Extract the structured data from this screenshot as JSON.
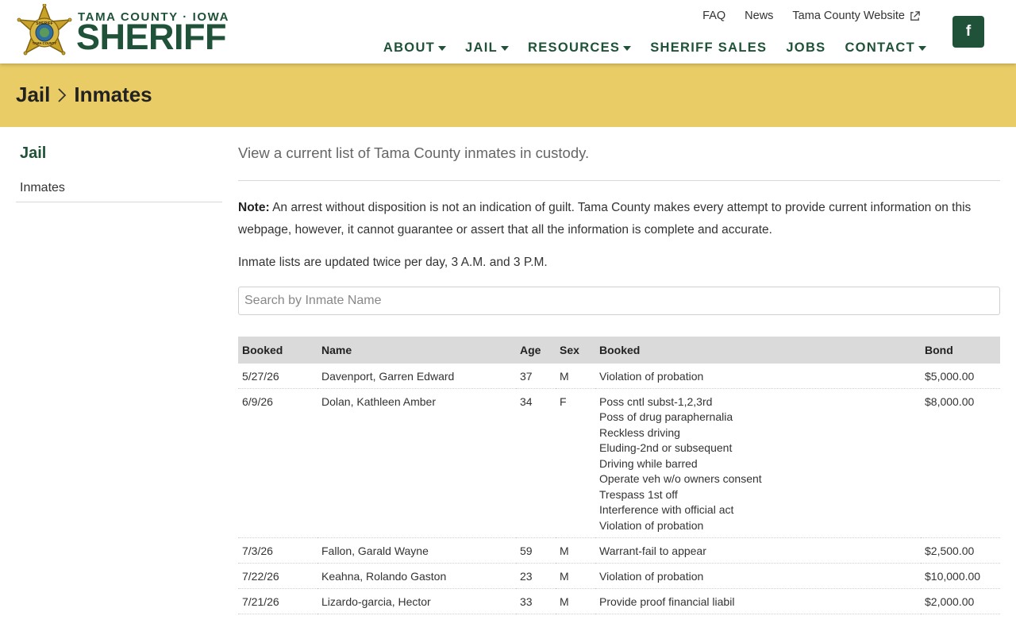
{
  "brand": {
    "subtitle": "TAMA COUNTY · IOWA",
    "title": "SHERIFF",
    "badge_text_top": "SHERIFF",
    "badge_text_bottom": "TAMA COUNTY"
  },
  "utility_nav": [
    {
      "label": "FAQ"
    },
    {
      "label": "News"
    },
    {
      "label": "Tama County Website",
      "icon": "external-link-icon"
    }
  ],
  "main_nav": [
    {
      "label": "ABOUT",
      "dropdown": true
    },
    {
      "label": "JAIL",
      "dropdown": true
    },
    {
      "label": "RESOURCES",
      "dropdown": true
    },
    {
      "label": "SHERIFF SALES",
      "dropdown": false
    },
    {
      "label": "JOBS",
      "dropdown": false
    },
    {
      "label": "CONTACT",
      "dropdown": true
    }
  ],
  "social": {
    "facebook_label": "f",
    "icon": "facebook-icon"
  },
  "breadcrumb": {
    "parent": "Jail",
    "current": "Inmates",
    "separator_icon": "chevron-right-icon"
  },
  "sidebar": {
    "title": "Jail",
    "items": [
      {
        "label": "Inmates"
      }
    ]
  },
  "content": {
    "lead": "View a current list of Tama County inmates in custody.",
    "note_label": "Note:",
    "note_text": "An arrest without disposition is not an indication of guilt. Tama County makes every attempt to provide current information on this webpage, however, it cannot guarantee or assert that all the information is complete and accurate.",
    "updated_text": "Inmate lists are updated twice per day, 3 A.M. and 3 P.M.",
    "search_placeholder": "Search by Inmate Name"
  },
  "table": {
    "headers": {
      "booked": "Booked",
      "name": "Name",
      "age": "Age",
      "sex": "Sex",
      "charges": "Booked",
      "bond": "Bond"
    },
    "rows": [
      {
        "booked": "5/27/26",
        "name": "Davenport, Garren Edward",
        "age": "37",
        "sex": "M",
        "charges": [
          "Violation of probation"
        ],
        "bond": "$5,000.00"
      },
      {
        "booked": "6/9/26",
        "name": "Dolan, Kathleen Amber",
        "age": "34",
        "sex": "F",
        "charges": [
          "Poss cntl subst-1,2,3rd",
          "Poss of drug paraphernalia",
          "Reckless driving",
          "Eluding-2nd or subsequent",
          "Driving while barred",
          "Operate veh w/o owners consent",
          "Trespass 1st off",
          "Interference with official act",
          "Violation of probation"
        ],
        "bond": "$8,000.00"
      },
      {
        "booked": "7/3/26",
        "name": "Fallon, Garald Wayne",
        "age": "59",
        "sex": "M",
        "charges": [
          "Warrant-fail to appear"
        ],
        "bond": "$2,500.00"
      },
      {
        "booked": "7/22/26",
        "name": "Keahna, Rolando Gaston",
        "age": "23",
        "sex": "M",
        "charges": [
          "Violation of probation"
        ],
        "bond": "$10,000.00"
      },
      {
        "booked": "7/21/26",
        "name": "Lizardo-garcia, Hector",
        "age": "33",
        "sex": "M",
        "charges": [
          "Provide proof financial liabil"
        ],
        "bond": "$2,000.00"
      }
    ]
  },
  "colors": {
    "brand_green": "#1f5238",
    "banner_gold": "#e9cc66",
    "badge_gold": "#c9a227",
    "header_row": "#dadada"
  }
}
